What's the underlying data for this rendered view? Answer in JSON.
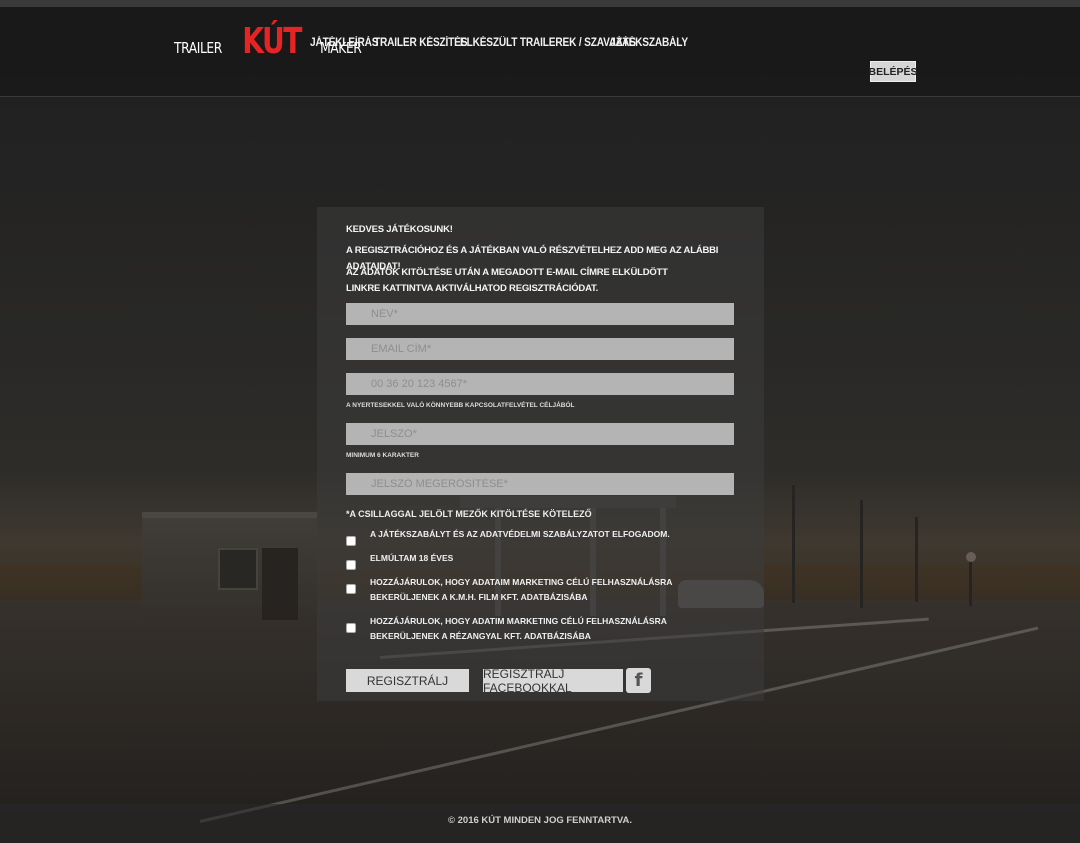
{
  "header": {
    "logo": {
      "part1": "TRAILER",
      "part2": "KÚT",
      "part3": "MAKER"
    },
    "nav": [
      {
        "label": "Játékleírás"
      },
      {
        "label": "Trailer készítés"
      },
      {
        "label": "Elkészült trailerek / szavazás"
      },
      {
        "label": "Játékszabály"
      }
    ],
    "login_label": "Belépés"
  },
  "form": {
    "greeting": "Kedves Játékosunk!",
    "intro": "A regisztrációhoz és a játékban való részvételhez add meg az alábbi adataidat!",
    "activation": "Az adatok kitöltése után a megadott e-mail címre elküldött linkre kattintva aktiválhatod regisztrációdat.",
    "name_placeholder": "Név*",
    "email_placeholder": "Email cím*",
    "phone_placeholder": "00 36 20 123 4567*",
    "phone_hint": "A nyertesekkel való könnyebb kapcsolatfelvétel céljából",
    "password_placeholder": "Jelszó*",
    "password_hint": "Minimum 6 karakter",
    "password_confirm_placeholder": "Jelszó megerősítése*",
    "required_note": "*A csillaggal jelölt mezők kitöltése kötelező",
    "checkboxes": [
      {
        "label": "A játékszabályt és az adatvédelmi szabályzatot elfogadom."
      },
      {
        "label": "Elmúltam 18 éves"
      },
      {
        "label": "Hozzájárulok, hogy adataim marketing célú felhasználásra bekerüljenek a K.M.H. Film Kft. adatbázisába"
      },
      {
        "label": "Hozzájárulok, hogy adatim marketing célú felhasználásra bekerüljenek a Rézangyal Kft. adatbázisába"
      }
    ],
    "register_label": "Regisztrálj",
    "register_fb_label": "Regisztrálj Facebookkal",
    "fb_icon_glyph": "f"
  },
  "footer": {
    "copyright": "© 2016 Kút minden jog fenntartva."
  }
}
